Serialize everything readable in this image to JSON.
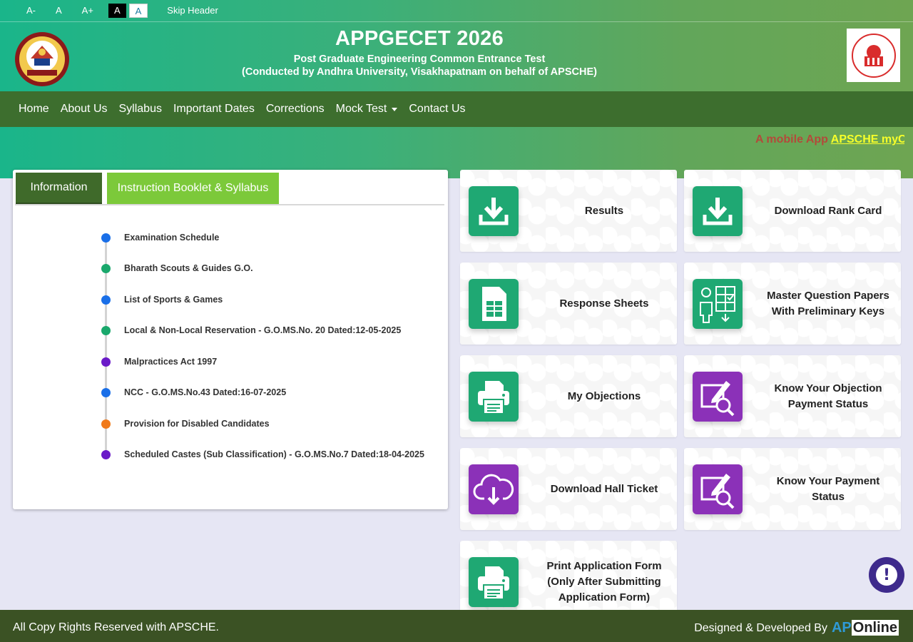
{
  "accessibility": {
    "font_decrease": "A-",
    "font_normal": "A",
    "font_increase": "A+",
    "contrast_dark": "A",
    "contrast_light": "A",
    "skip_header": "Skip Header"
  },
  "header": {
    "title": "APPGECET 2026",
    "subtitle": "Post Graduate Engineering Common Entrance Test",
    "conducted_by": "(Conducted by Andhra University, Visakhapatnam on behalf of APSCHE)"
  },
  "nav": {
    "items": [
      "Home",
      "About Us",
      "Syllabus",
      "Important Dates",
      "Corrections",
      "Mock Test",
      "Contact Us"
    ]
  },
  "marquee": {
    "text": "A mobile App ",
    "link": "APSCHE myC"
  },
  "tabs": {
    "information": "Information",
    "booklet": "Instruction Booklet & Syllabus"
  },
  "info_links": [
    {
      "label": "Examination Schedule",
      "color": "#1a6fe8"
    },
    {
      "label": "Bharath Scouts & Guides G.O.",
      "color": "#1aa86c"
    },
    {
      "label": "List of Sports & Games",
      "color": "#1a6fe8"
    },
    {
      "label": "Local & Non-Local Reservation - G.O.MS.No. 20 Dated:12-05-2025",
      "color": "#1aa86c"
    },
    {
      "label": "Malpractices Act 1997",
      "color": "#6a1ac8"
    },
    {
      "label": "NCC - G.O.MS.No.43 Dated:16-07-2025",
      "color": "#1a6fe8"
    },
    {
      "label": "Provision for Disabled Candidates",
      "color": "#f07a1a"
    },
    {
      "label": "Scheduled Castes (Sub Classification) - G.O.MS.No.7 Dated:18-04-2025",
      "color": "#6a1ac8"
    }
  ],
  "cards": {
    "results": "Results",
    "rank_card": "Download Rank Card",
    "response_sheets": "Response Sheets",
    "master_papers": "Master Question Papers With Preliminary Keys",
    "my_objections": "My Objections",
    "objection_payment": "Know Your Objection Payment Status",
    "hall_ticket": "Download Hall Ticket",
    "payment_status": "Know Your Payment Status",
    "print_form": "Print Application Form (Only After Submitting Application Form)"
  },
  "help": {
    "symbol": "!"
  },
  "footer": {
    "copyright": "All Copy Rights Reserved with APSCHE.",
    "designed_by": "Designed & Developed By",
    "ap": "AP",
    "online": "Online"
  },
  "colors": {
    "nav_bg": "#3d6e2e",
    "tab_active": "#3f6a2a",
    "tab_inactive": "#7cc93a",
    "icon_green": "#1fa873",
    "icon_purple": "#8b31b8",
    "footer_bg": "#3b5224"
  }
}
